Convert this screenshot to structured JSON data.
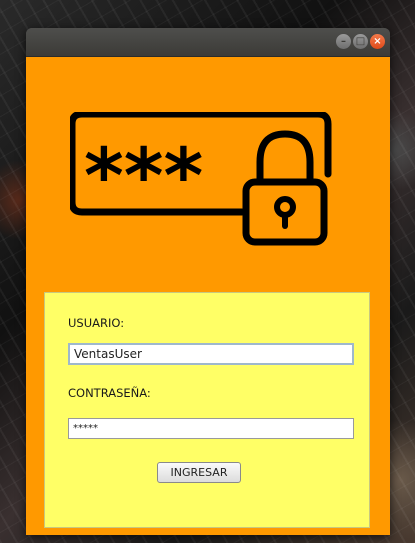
{
  "window": {
    "controls": {
      "minimize_icon": "minimize-icon",
      "maximize_icon": "maximize-icon",
      "close_icon": "close-icon"
    }
  },
  "logo": {
    "icon": "password-lock-icon",
    "stars": "***"
  },
  "form": {
    "user_label": "USUARIO:",
    "user_value": "VentasUser",
    "password_label": "CONTRASEÑA:",
    "password_value": "*****",
    "submit_label": "INGRESAR"
  },
  "colors": {
    "window_background": "#ff9900",
    "panel_background": "#ffff66",
    "logo_stroke": "#000000",
    "close_button": "#df4a1a"
  }
}
